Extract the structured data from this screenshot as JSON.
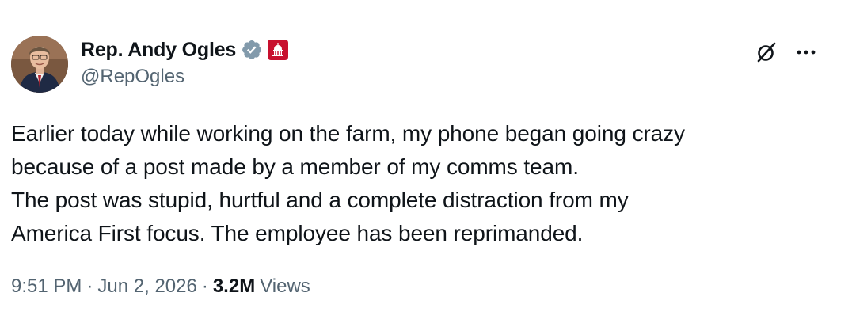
{
  "author": {
    "display_name": "Rep. Andy Ogles",
    "handle": "@RepOgles",
    "verified_icon": "verified-badge-icon",
    "affiliation_icon": "us-capitol-badge-icon",
    "colors": {
      "verified": "#829aab",
      "affiliation_badge": "#c8102e"
    }
  },
  "header_actions": {
    "grok_icon": "grok-icon",
    "more_icon": "more-options-icon"
  },
  "tweet": {
    "lines": [
      "Earlier today while working on the farm, my phone began going crazy",
      "because of a post made by a member of my comms team.",
      "The post was stupid, hurtful and a complete distraction from my",
      "America First focus. The employee has been reprimanded."
    ]
  },
  "meta": {
    "time": "9:51 PM",
    "separator": "·",
    "date": "Jun 2, 2026",
    "views_count": "3.2M",
    "views_label": "Views"
  }
}
